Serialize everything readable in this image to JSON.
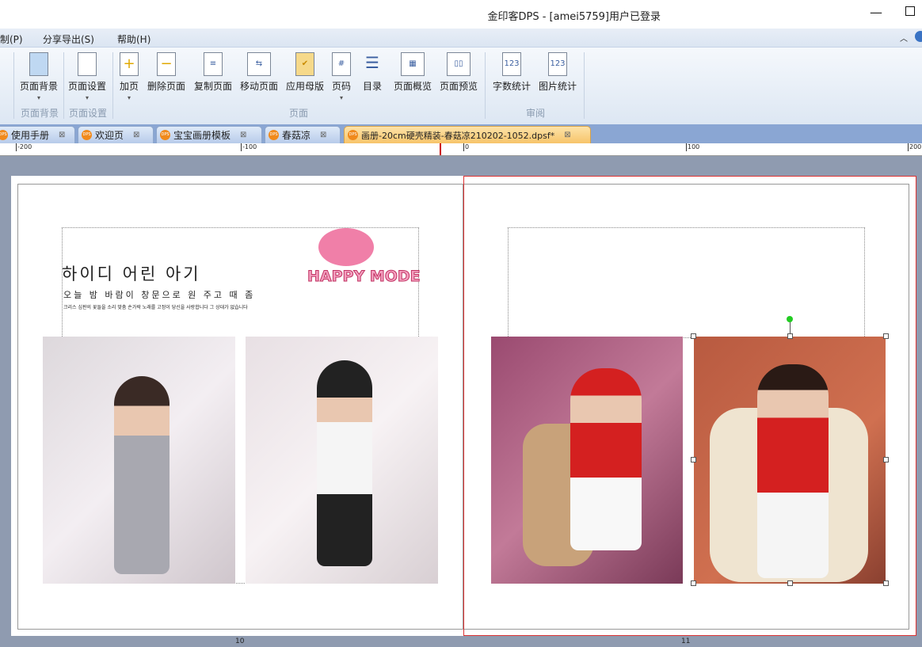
{
  "window": {
    "title": "金印客DPS - [amei5759]用户已登录"
  },
  "menu": [
    "制(P)",
    "分享导出(S)",
    "帮助(H)"
  ],
  "ribbon": {
    "buttons": [
      {
        "label": "页面背景",
        "icon": "paint-bucket-icon"
      },
      {
        "label": "页面设置",
        "icon": "page-setup-icon"
      },
      {
        "label": "加页",
        "icon": "add-page-icon"
      },
      {
        "label": "删除页面",
        "icon": "delete-page-icon"
      },
      {
        "label": "复制页面",
        "icon": "copy-page-icon"
      },
      {
        "label": "移动页面",
        "icon": "move-page-icon"
      },
      {
        "label": "应用母版",
        "icon": "apply-master-icon"
      },
      {
        "label": "页码",
        "icon": "page-number-icon"
      },
      {
        "label": "目录",
        "icon": "toc-icon"
      },
      {
        "label": "页面概览",
        "icon": "overview-icon"
      },
      {
        "label": "页面预览",
        "icon": "preview-icon"
      },
      {
        "label": "字数统计",
        "icon": "word-count-icon"
      },
      {
        "label": "图片统计",
        "icon": "image-count-icon"
      }
    ],
    "groups": [
      "页面背景",
      "页面设置",
      "页面",
      "审阅"
    ]
  },
  "tabs": [
    "使用手册",
    "欢迎页",
    "宝宝画册模板",
    "春菇凉",
    "画册-20cm硬壳精装-春菇凉210202-1052.dpsf*"
  ],
  "ruler": [
    "-200",
    "-100",
    "0",
    "100",
    "200"
  ],
  "page_text": {
    "heading": "하이디 어린 아기",
    "subheading": "오늘 밤 바람이 창문으로 원 주고 때 좀",
    "body": "크리스 심판의 꽃들을 소리 맞춤 손가락 노래를 고정이 당신을 사랑합니다 그 상대가 없습니다",
    "logo": "HAPPY MODE"
  },
  "page_numbers": [
    "10",
    "11"
  ],
  "colors": {
    "accent": "#f7c46a",
    "selection": "#d33"
  }
}
